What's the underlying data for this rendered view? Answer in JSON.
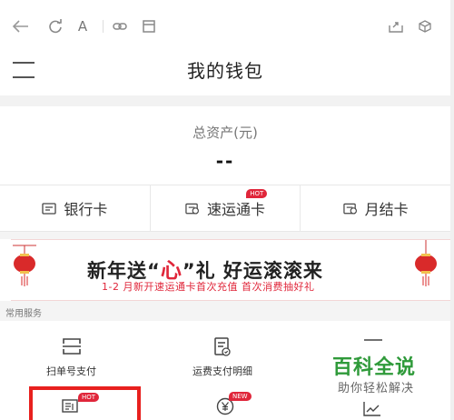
{
  "browser_toolbar": {
    "icons": [
      "back-arrow-icon",
      "refresh-icon",
      "text-size-icon",
      "link-icon",
      "layout-icon",
      "share-icon",
      "cube-icon"
    ],
    "text_size_glyph": "A"
  },
  "header": {
    "title": "我的钱包"
  },
  "assets": {
    "label": "总资产(元)",
    "value": "--"
  },
  "cards": [
    {
      "label": "银行卡",
      "icon": "bank-card-icon"
    },
    {
      "label": "速运通卡",
      "icon": "express-card-icon",
      "badge": "HOT"
    },
    {
      "label": "月结卡",
      "icon": "monthly-card-icon"
    }
  ],
  "banner": {
    "title_part1": "新年送",
    "title_quote_open": "“",
    "title_heart": "心",
    "title_quote_close": "”",
    "title_part2": "礼  好运滚滚来",
    "subtitle": "1-2 月新开速运通卡首次充值 首次消费抽好礼",
    "accent_color": "#e0263a"
  },
  "services": {
    "title": "常用服务",
    "items": [
      {
        "label": "扫单号支付",
        "icon": "scan-icon"
      },
      {
        "label": "运费支付明细",
        "icon": "bill-detail-icon"
      },
      {
        "label": "",
        "icon": "chart-icon"
      },
      {
        "label": "",
        "icon": "invoice-icon",
        "badge": "HOT"
      },
      {
        "label": "",
        "icon": "yen-coin-icon",
        "badge": "NEW"
      },
      {
        "label": "",
        "icon": "trend-icon"
      }
    ]
  },
  "watermark": {
    "title": "百科全说",
    "subtitle": "助你轻松解决"
  }
}
